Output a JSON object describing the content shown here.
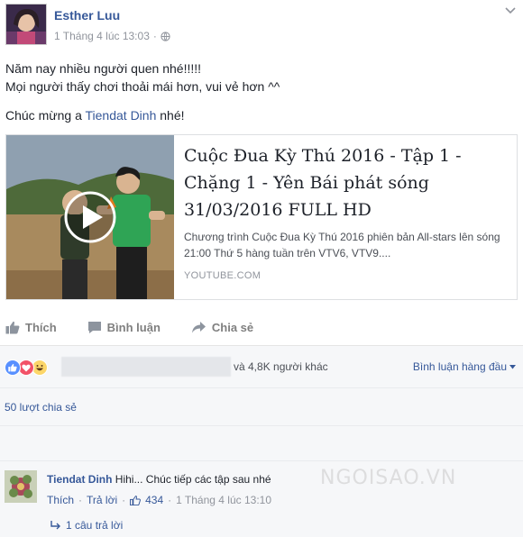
{
  "post": {
    "author": "Esther Luu",
    "timestamp": "1 Tháng 4 lúc 13:03",
    "audience_icon": "globe-icon",
    "text_line1": "Năm nay nhiều người quen nhé!!!!!",
    "text_line2": "Mọi người thấy chơi thoải mái hơn, vui vẻ hơn ^^",
    "text_line3_prefix": "Chúc mừng a ",
    "mention": "Tiendat Dinh",
    "text_line3_suffix": " nhé!"
  },
  "link": {
    "title": "Cuộc Đua Kỳ Thú 2016 - Tập 1 - Chặng 1 - Yên Bái phát sóng 31/03/2016 FULL HD",
    "description": "Chương trình Cuộc Đua Kỳ Thú 2016 phiên bản All-stars lên sóng 21:00 Thứ 5 hàng tuần trên VTV6, VTV9....",
    "domain": "YOUTUBE.COM"
  },
  "actions": {
    "like": "Thích",
    "comment": "Bình luận",
    "share": "Chia sẻ"
  },
  "reactions": {
    "text": "và 4,8K người khác",
    "order": "Bình luận hàng đầu",
    "icons": [
      "like-icon",
      "love-icon",
      "haha-icon"
    ],
    "colors": {
      "like": "#5890ff",
      "love": "#f25268",
      "haha": "#fcd669"
    }
  },
  "shares": {
    "text": "50 lượt chia sẻ"
  },
  "comment": {
    "author": "Tiendat Dinh",
    "text": "Hihi... Chúc tiếp các tập sau nhé",
    "like_label": "Thích",
    "reply_label": "Trả lời",
    "like_count": "434",
    "timestamp": "1 Tháng 4 lúc 13:10",
    "replies": "1 câu trả lời"
  },
  "watermark": "NGOISAO.VN",
  "colors": {
    "link_blue": "#365899",
    "meta_gray": "#90949c",
    "panel_bg": "#f6f7f9"
  }
}
